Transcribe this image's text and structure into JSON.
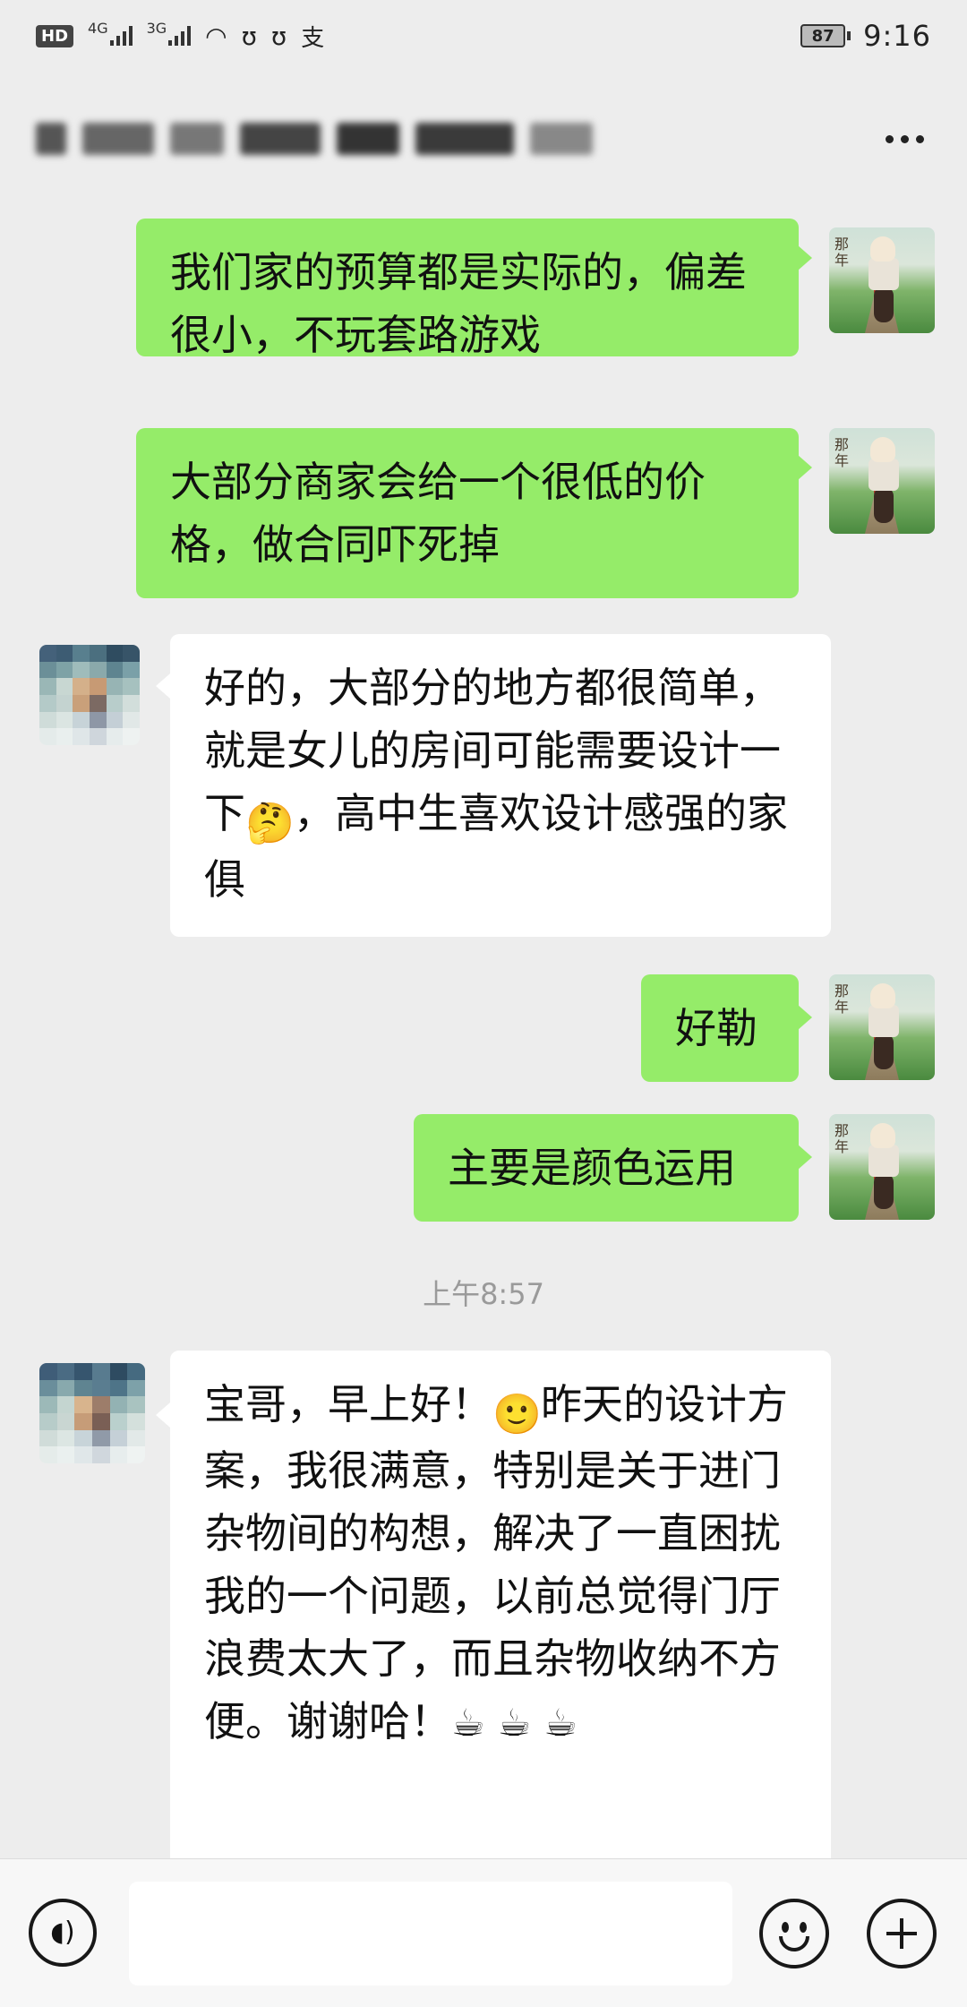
{
  "status_bar": {
    "hd_label": "HD",
    "net1": "4G",
    "net2": "3G",
    "battery": "87",
    "time": "9:16",
    "icons": [
      "hd-icon",
      "signal-icon",
      "wifi-icon",
      "notification-icon",
      "alipay-icon",
      "battery-icon"
    ]
  },
  "header": {
    "more_icon": "more-dots-icon"
  },
  "messages": [
    {
      "side": "mine",
      "text": "我们家的预算都是实际的，偏差很小，不玩套路游戏"
    },
    {
      "side": "mine",
      "text": "大部分商家会给一个很低的价格，做合同吓死掉"
    },
    {
      "side": "theirs",
      "text_a": "好的，大部分的地方都很简单，就是女儿的房间可能需要设计一下",
      "emoji": "🤔",
      "text_b": "，高中生喜欢设计感强的家俱"
    },
    {
      "side": "mine",
      "text": "好勒"
    },
    {
      "side": "mine",
      "text": "主要是颜色运用"
    },
    {
      "side": "theirs",
      "text_a": "宝哥，早上好！",
      "emoji": "🙂",
      "text_b": "昨天的设计方案，我很满意，特别是关于进门杂物间的构想，解决了一直困扰我的一个问题，以前总觉得门厅浪费太大了，而且杂物收纳不方便。谢谢哈！",
      "trail_emoji": "☕☕☕"
    }
  ],
  "timestamp": "上午8:57",
  "avatar_text": "那年",
  "input_bar": {
    "voice_icon": "voice-icon",
    "emoji_icon": "emoji-icon",
    "plus_icon": "plus-icon",
    "placeholder": ""
  },
  "colors": {
    "background": "#ededed",
    "mine_bubble": "#95ec69",
    "theirs_bubble": "#ffffff",
    "timestamp": "#9a9a9a"
  }
}
